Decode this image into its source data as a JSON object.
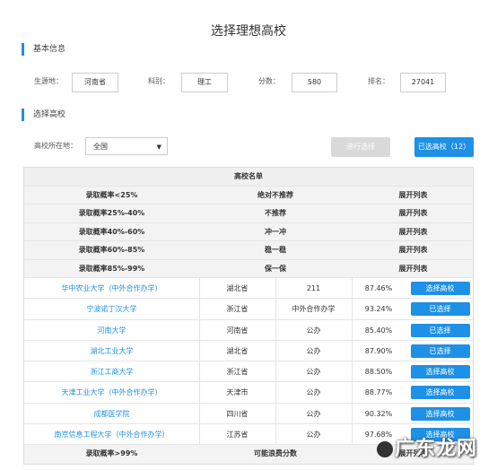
{
  "title": "选择理想高校",
  "basic": {
    "section_title": "基本信息",
    "origin_label": "生源地：",
    "origin_value": "河南省",
    "subject_label": "科别：",
    "subject_value": "理工",
    "score_label": "分数：",
    "score_value": "580",
    "rank_label": "排名：",
    "rank_value": "27041"
  },
  "choose": {
    "section_title": "选择高校",
    "region_label": "高校所在地：",
    "region_value": "全国",
    "submit_label": "进行选择",
    "selected_label": "已选高校（12）"
  },
  "table": {
    "header": "高校名单",
    "categories_top": [
      {
        "prob": "录取概率<25%",
        "advice": "绝对不推荐",
        "action": "展开列表"
      },
      {
        "prob": "录取概率25%-40%",
        "advice": "不推荐",
        "action": "展开列表"
      },
      {
        "prob": "录取概率40%-60%",
        "advice": "冲一冲",
        "action": "展开列表"
      },
      {
        "prob": "录取概率60%-85%",
        "advice": "稳一稳",
        "action": "展开列表"
      },
      {
        "prob": "录取概率85%-99%",
        "advice": "保一保",
        "action": "展开列表"
      }
    ],
    "rows": [
      {
        "school": "华中农业大学（中外合作办学）",
        "province": "湖北省",
        "type": "211",
        "rate": "87.46%",
        "button": "选择高校"
      },
      {
        "school": "宁波诺丁汉大学",
        "province": "浙江省",
        "type": "中外合作办学",
        "rate": "93.24%",
        "button": "已选择"
      },
      {
        "school": "河南大学",
        "province": "河南省",
        "type": "公办",
        "rate": "85.40%",
        "button": "已选择"
      },
      {
        "school": "湖北工业大学",
        "province": "湖北省",
        "type": "公办",
        "rate": "87.90%",
        "button": "已选择"
      },
      {
        "school": "浙江工商大学",
        "province": "浙江省",
        "type": "公办",
        "rate": "88.50%",
        "button": "选择高校"
      },
      {
        "school": "天津工业大学（中外合作办学）",
        "province": "天津市",
        "type": "公办",
        "rate": "88.77%",
        "button": "选择高校"
      },
      {
        "school": "成都医学院",
        "province": "四川省",
        "type": "公办",
        "rate": "90.32%",
        "button": "选择高校"
      },
      {
        "school": "南京信息工程大学（中外合作办学）",
        "province": "江苏省",
        "type": "公办",
        "rate": "97.68%",
        "button": "选择高校"
      }
    ],
    "bottom": {
      "prob": "录取概率>99%",
      "advice": "可能浪费分数",
      "action": "展开列表"
    }
  },
  "watermark": "广东龙网"
}
